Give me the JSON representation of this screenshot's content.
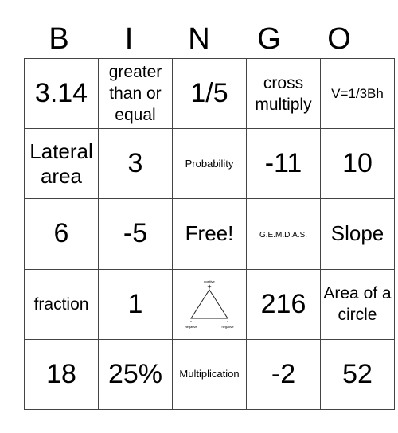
{
  "header": [
    "B",
    "I",
    "N",
    "G",
    "O"
  ],
  "rows": [
    [
      {
        "text": "3.14",
        "size": "xl"
      },
      {
        "text": "greater than or equal",
        "size": "md"
      },
      {
        "text": "1/5",
        "size": "xl"
      },
      {
        "text": "cross multiply",
        "size": "md"
      },
      {
        "text": "V=1/3Bh",
        "size": "sm"
      }
    ],
    [
      {
        "text": "Lateral area",
        "size": "lg"
      },
      {
        "text": "3",
        "size": "xl"
      },
      {
        "text": "Probability",
        "size": "xs"
      },
      {
        "text": "-11",
        "size": "xl"
      },
      {
        "text": "10",
        "size": "xl"
      }
    ],
    [
      {
        "text": "6",
        "size": "xl"
      },
      {
        "text": "-5",
        "size": "xl"
      },
      {
        "text": "Free!",
        "size": "lg"
      },
      {
        "text": "G.E.M.D.A.S.",
        "size": "xxs"
      },
      {
        "text": "Slope",
        "size": "lg"
      }
    ],
    [
      {
        "text": "fraction",
        "size": "md"
      },
      {
        "text": "1",
        "size": "xl"
      },
      {
        "image": "sign-triangle",
        "top_label": "positive",
        "top_sign": "+",
        "left_label": "negative",
        "left_sign": "-",
        "right_label": "negative",
        "right_sign": "-"
      },
      {
        "text": "216",
        "size": "xl"
      },
      {
        "text": "Area of a circle",
        "size": "md"
      }
    ],
    [
      {
        "text": "18",
        "size": "xl"
      },
      {
        "text": "25%",
        "size": "xl"
      },
      {
        "text": "Multiplication",
        "size": "xs"
      },
      {
        "text": "-2",
        "size": "xl"
      },
      {
        "text": "52",
        "size": "xl"
      }
    ]
  ]
}
